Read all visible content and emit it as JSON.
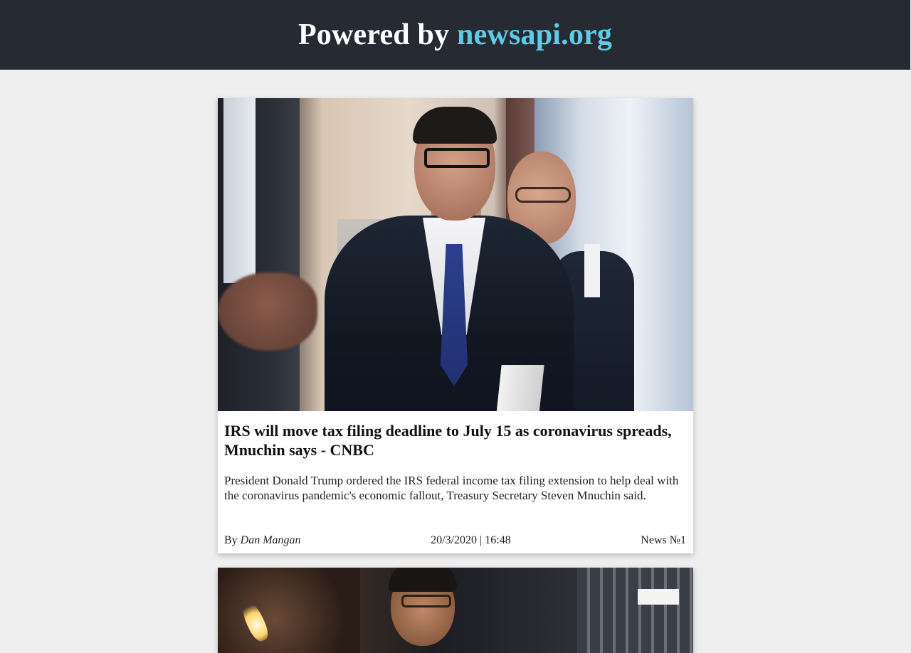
{
  "header": {
    "prefix": "Powered by ",
    "link_text": "newsapi.org",
    "link_color": "#5ecbe8",
    "background": "#262a33"
  },
  "articles": [
    {
      "image_alt": "Steven Mnuchin walking with aides",
      "title": "IRS will move tax filing deadline to July 15 as coronavirus spreads, Mnuchin says - CNBC",
      "description": "President Donald Trump ordered the IRS federal income tax filing extension to help deal with the coronavirus pandemic's economic fallout, Treasury Secretary Steven Mnuchin said.",
      "by_label": "By ",
      "author": "Dan Mangan",
      "datetime": "20/3/2020 | 16:48",
      "number_label": "News №1"
    },
    {
      "image_alt": "People holding candles at night vigil"
    }
  ]
}
